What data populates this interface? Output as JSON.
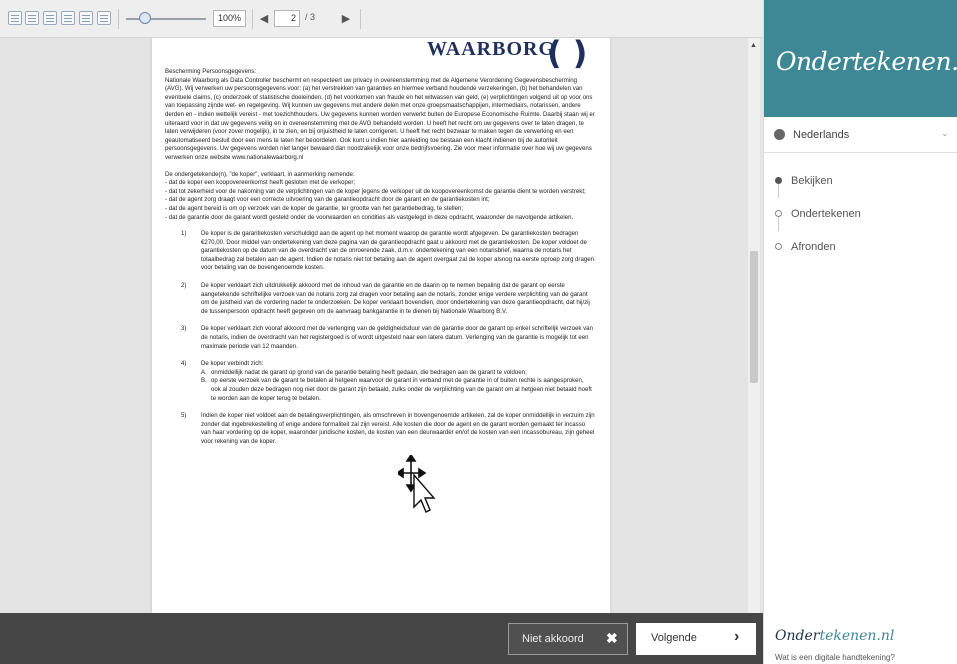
{
  "toolbar": {
    "zoom": "100%",
    "page_current": "2",
    "page_total": "/ 3",
    "prev_icon": "caret-left-icon",
    "next_icon": "caret-right-icon"
  },
  "document": {
    "logo": "WAARBORG",
    "privacy_text": "Bescherming Persoonsgegevens:\nNationale Waarborg als Data Controller beschermt en respecteert uw privacy in overeenstemming met de Algemene Verordening Gegevensbescherming (AVG). Wij verwerken uw persoonsgegevens voor: (a) het verstrekken van garanties en hiermee verband houdende verzekeringen, (b) het behandelen van eventuele claims, (c) onderzoek of statistische doeleinden, (d) het voorkomen van fraude en het witwassen van geld, (e) verplichtingen volgend uit op voor ons van toepassing zijnde wet- en regelgeving. Wij kunnen uw gegevens met andere delen met onze groepsmaatschappijen, intermediairs, notarissen, andere derden en - indien wettelijk vereist - met toezichthouders. Uw gegevens kunnen worden verwerkt buiten de Europese Economische Ruimte. Daarbij staan wij er uiteraard voor in dat uw gegevens veilig en in overeenstemming met de AVG behandeld worden. U heeft het recht om uw gegevens over te laten dragen, te laten verwijderen (voor zover mogelijk), in te zien, en bij onjuistheid te laten corrigeren. U heeft het recht bezwaar te maken tegen de verwerking en een geautomatiseerd besluit door een mens te laten her beoordelen. Ook kunt u indien hier aanleiding toe bestaan een klacht indienen bij de autoriteit persoonsgegevens. Uw gegevens worden niet langer bewaard dan noodzakelijk voor onze bedrijfsvoering. Zie voor meer informatie over hoe wij uw gegevens verwerken onze website www.nationalewaarborg.nl",
    "declaration_text": "De ondergetekende(n), \"de koper\", verklaart, in aanmerking nemende:\n- dat de koper een koopovereenkomst heeft gesloten met de verkoper;\n- dat tot zekerheid voor de nakoming van de verplichtingen van de koper jegens de verkoper uit de koopovereenkomst de garantie dient te worden verstrekt;\n- dat de agent zorg draagt voor een correcte uitvoering van de garantieopdracht door de garant en de garantiekosten int;\n- dat de agent bereid is om op verzoek van de koper de garantie, ter grootte van het garantiebedrag, te stellen;\n- dat de garantie door de garant wordt gesteld onder de voorwaarden en condities als vastgelegd in deze opdracht, waaronder de navolgende artikelen.",
    "items": [
      {
        "num": "1)",
        "text": "De koper is de garantiekosten verschuldigd aan de agent op het moment waarop de garantie wordt afgegeven. De garantiekosten bedragen €270,00. Door middel van ondertekening van deze pagina van de garantieopdracht gaat u akkoord met de garantiekosten. De koper voldoet de garantiekosten op de datum van de overdracht van de onroerende zaak, d.m.v. ondertekening van een notarisbrief, waarna de notaris het totaalbedrag zal betalen aan de agent. Indien de notaris niet tot betaling aan de agent overgaat zal de koper alsnog na eerste oproep zorg dragen voor betaling van de bovengenoemde kosten."
      },
      {
        "num": "2)",
        "text": "De koper verklaart zich uitdrukkelijk akkoord met de inhoud van de garantie en de daarin op te nemen bepaling dat de garant op eerste aangetekende schriftelijke verzoek van de notaris zorg zal dragen voor betaling aan de notaris, zonder enige verdere verplichting van de garant om de juistheid van de vordering nader te onderzoeken. De koper verklaart bovendien, door ondertekening van deze garantieopdracht, dat hij/zij de tussenpersoon opdracht heeft gegeven om de aanvraag bankgarantie in te dienen bij Nationale Waarborg B.V."
      },
      {
        "num": "3)",
        "text": "De koper verklaart zich vooraf akkoord met de verlenging van de geldigheidsduur van de garantie door de garant op enkel schriftelijk verzoek van de notaris, indien de overdracht van het registergoed is of wordt uitgesteld naar een latere datum. Verlenging van de garantie is mogelijk tot een maximale periode van 12 maanden."
      },
      {
        "num": "4)",
        "text": "De koper verbindt zich:"
      },
      {
        "num": "5)",
        "text": "Indien de koper niet voldoet aan de betalingsverplichtingen, als omschreven in bovengenoemde artikelen, zal de koper onmiddellijk in verzuim zijn zonder dat ingebrekestelling of enige andere formaliteit zal zijn vereist. Alle kosten die door de agent en de garant worden gemaakt ter incasso van haar vordering op de koper, waaronder juridische kosten, de kosten van een deurwaarder en/of de kosten van een incassobureau, zijn geheel voor rekening van de koper."
      }
    ],
    "sub_items": [
      {
        "letter": "A.",
        "text": "onmiddellijk nadat de garant op grond van de garantie betaling heeft gedaan, die bedragen aan de garant te voldoen;"
      },
      {
        "letter": "B.",
        "text": "op eerste verzoek van de garant te betalen al hetgeen waarvoor de garant in verband met de garantie in of buiten rechte is aangesproken, ook al zouden deze bedragen nog niet door de garant zijn betaald, zulks onder de verplichting van de garant om al hetgeen niet betaald hoeft te worden aan de koper terug te betalen."
      }
    ]
  },
  "sidebar": {
    "brand": "Ondertekenen.nl",
    "language": "Nederlands",
    "steps": [
      "Bekijken",
      "Ondertekenen",
      "Afronden"
    ],
    "mini_brand_a": "Onder",
    "mini_brand_b": "tekenen.nl",
    "help_link": "Wat is een digitale handtekening?"
  },
  "footer": {
    "decline_label": "Niet akkoord",
    "next_label": "Volgende",
    "decline_icon": "close-icon",
    "next_icon": "chevron-right-icon"
  },
  "colors": {
    "brand": "#3e8896",
    "footer": "#464646"
  }
}
